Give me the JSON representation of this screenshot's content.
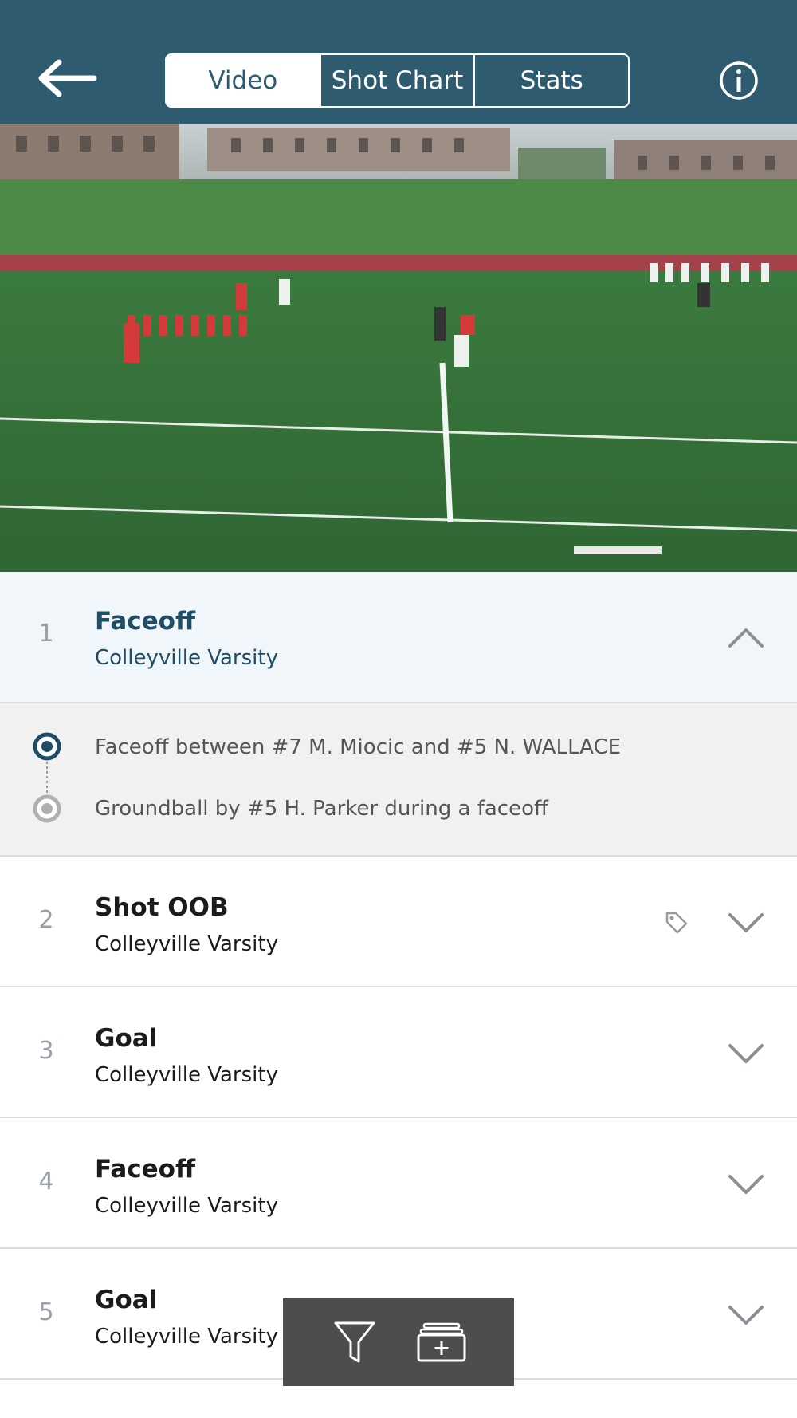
{
  "header": {
    "tabs": [
      {
        "label": "Video",
        "active": true
      },
      {
        "label": "Shot Chart",
        "active": false
      },
      {
        "label": "Stats",
        "active": false
      }
    ],
    "back_icon": "arrow-left-icon",
    "info_icon": "info-icon",
    "bar_color": "#2e5b70"
  },
  "plays": [
    {
      "number": "1",
      "title": "Faceoff",
      "team": "Colleyville Varsity",
      "expanded": true,
      "events": [
        "Faceoff between #7 M. Miocic and #5 N. WALLACE",
        "Groundball by #5 H. Parker during a faceoff"
      ]
    },
    {
      "number": "2",
      "title": "Shot OOB",
      "team": "Colleyville Varsity",
      "tagged": true
    },
    {
      "number": "3",
      "title": "Goal",
      "team": "Colleyville Varsity"
    },
    {
      "number": "4",
      "title": "Faceoff",
      "team": "Colleyville Varsity"
    },
    {
      "number": "5",
      "title": "Goal",
      "team": "Colleyville Varsity"
    }
  ],
  "toolbar": {
    "filter_icon": "filter-icon",
    "add_playlist_icon": "add-to-playlist-icon"
  }
}
